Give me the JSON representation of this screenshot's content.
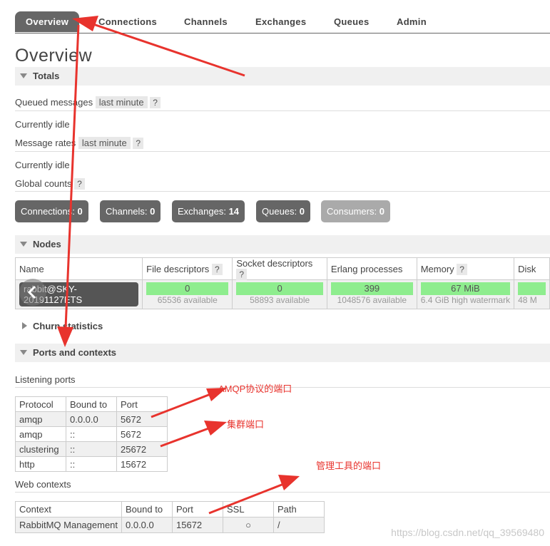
{
  "tabs": [
    "Overview",
    "Connections",
    "Channels",
    "Exchanges",
    "Queues",
    "Admin"
  ],
  "page_title": "Overview",
  "totals": {
    "section_label": "Totals",
    "queued_messages_label": "Queued messages",
    "period": "last minute",
    "help": "?",
    "queued_status": "Currently idle",
    "message_rates_label": "Message rates",
    "rates_status": "Currently idle",
    "global_counts_label": "Global counts"
  },
  "counts": [
    {
      "label": "Connections:",
      "value": "0"
    },
    {
      "label": "Channels:",
      "value": "0"
    },
    {
      "label": "Exchanges:",
      "value": "14"
    },
    {
      "label": "Queues:",
      "value": "0"
    },
    {
      "label": "Consumers:",
      "value": "0"
    }
  ],
  "nodes": {
    "section_label": "Nodes",
    "headers": [
      "Name",
      "File descriptors",
      "Socket descriptors",
      "Erlang processes",
      "Memory",
      "Disk"
    ],
    "node_name": "rabbit@SKY-20191127ETS",
    "file_descriptors": {
      "value": "0",
      "sub": "65536 available"
    },
    "socket_descriptors": {
      "value": "0",
      "sub": "58893 available"
    },
    "erlang_processes": {
      "value": "399",
      "sub": "1048576 available"
    },
    "memory": {
      "value": "67 MiB",
      "sub": "6.4 GiB high watermark"
    },
    "disk": {
      "sub": "48 M"
    }
  },
  "churn": {
    "section_label": "Churn statistics"
  },
  "ports": {
    "section_label": "Ports and contexts",
    "listening_label": "Listening ports",
    "headers": [
      "Protocol",
      "Bound to",
      "Port"
    ],
    "rows": [
      [
        "amqp",
        "0.0.0.0",
        "5672"
      ],
      [
        "amqp",
        "::",
        "5672"
      ],
      [
        "clustering",
        "::",
        "25672"
      ],
      [
        "http",
        "::",
        "15672"
      ]
    ],
    "web_label": "Web contexts",
    "web_headers": [
      "Context",
      "Bound to",
      "Port",
      "SSL",
      "Path"
    ],
    "web_rows": [
      [
        "RabbitMQ Management",
        "0.0.0.0",
        "15672",
        "○",
        "/"
      ]
    ]
  },
  "annotations": {
    "amqp_port": "AMQP协议的端口",
    "cluster_port": "集群端口",
    "mgmt_port": "管理工具的端口"
  },
  "watermark": "https://blog.csdn.net/qq_39569480",
  "colors": {
    "annotation": "#e8332d",
    "bar_fill": "#8eed8e",
    "tab_active": "#666666"
  }
}
